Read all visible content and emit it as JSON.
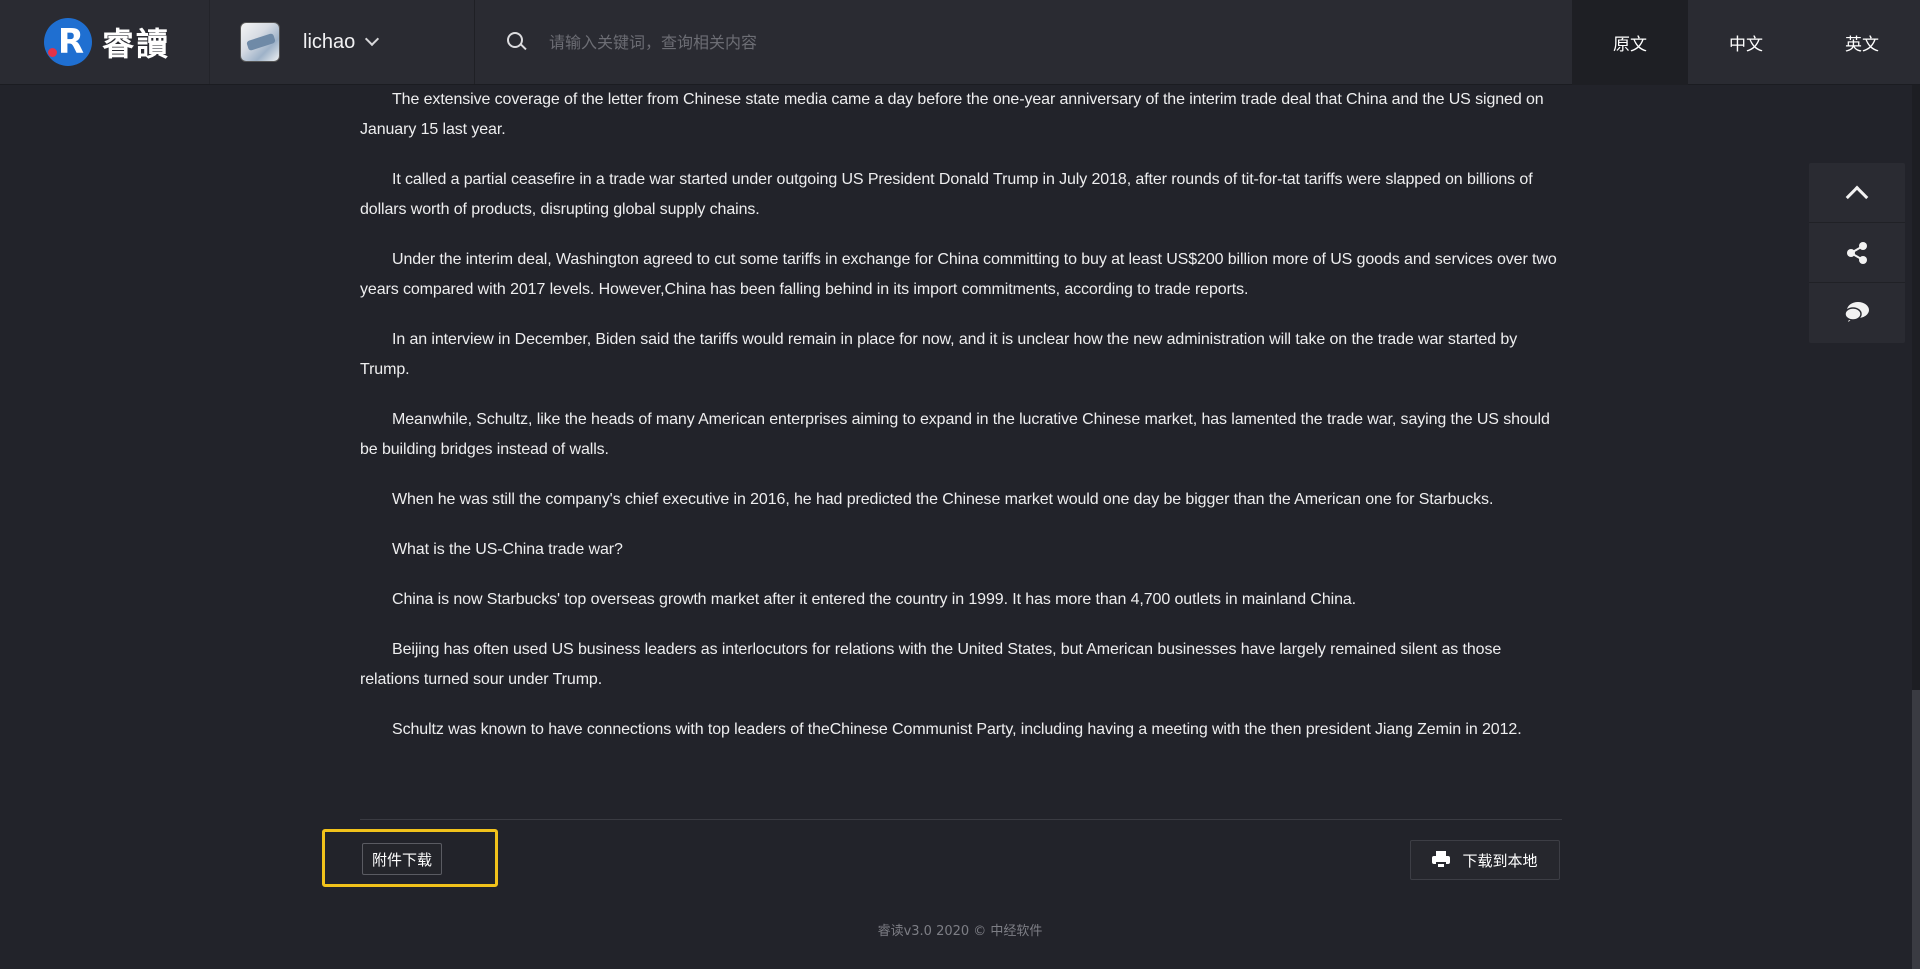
{
  "header": {
    "logo_text": "睿讀",
    "logo_letter": "R",
    "user": {
      "name": "lichao"
    },
    "search": {
      "placeholder": "请输入关键词，查询相关内容"
    },
    "lang_tabs": [
      {
        "label": "原文",
        "active": true
      },
      {
        "label": "中文",
        "active": false
      },
      {
        "label": "英文",
        "active": false
      }
    ]
  },
  "article": {
    "paragraphs": [
      "The extensive coverage of the letter from Chinese state media came a day before the one-year anniversary of the interim trade deal that China and the US signed on January 15 last year.",
      "It called a partial ceasefire in a trade war started under outgoing US President Donald Trump in July 2018, after rounds of tit-for-tat tariffs were slapped on billions of dollars worth of products, disrupting global supply chains.",
      "Under the interim deal, Washington agreed to cut some tariffs in exchange for China committing to buy at least US$200 billion more of US goods and services over two years compared with 2017 levels. However,China has been falling behind in its import commitments, according to trade reports.",
      "In an interview in December, Biden said the tariffs would remain in place for now, and it is unclear how the new administration will take on the trade war started by Trump.",
      "Meanwhile, Schultz, like the heads of many American enterprises aiming to expand in the lucrative Chinese market, has lamented the trade war, saying the US should be building bridges instead of walls.",
      "When he was still the company's chief executive in 2016, he had predicted the Chinese market would one day be bigger than the American one for Starbucks.",
      "What is the US-China trade war?",
      "China is now Starbucks' top overseas growth market after it entered the country in 1999. It has more than 4,700 outlets in mainland China.",
      "Beijing has often used US business leaders as interlocutors for relations with the United States, but American businesses have largely remained silent as those relations turned sour under Trump.",
      "Schultz was known to have connections with top leaders of theChinese Communist Party, including having a meeting with the then president Jiang Zemin in 2012."
    ]
  },
  "actions": {
    "attachment_label": "附件下载",
    "download_label": "下载到本地"
  },
  "footer": {
    "text": "睿读v3.0 2020 © 中经软件"
  },
  "float_tools": {
    "items": [
      {
        "icon": "chevron-up-icon"
      },
      {
        "icon": "share-icon"
      },
      {
        "icon": "comment-icon"
      }
    ]
  },
  "colors": {
    "background": "#22232a",
    "topbar": "#2a2b32",
    "logo_blue": "#1f6fd1",
    "logo_red": "#e2334a",
    "highlight": "#f1c21b"
  }
}
